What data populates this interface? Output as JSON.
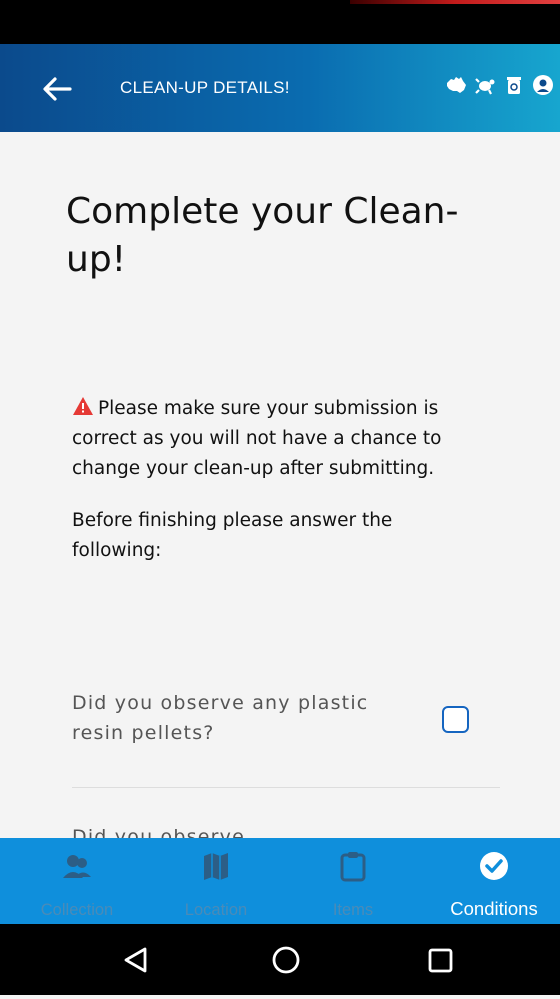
{
  "app_bar": {
    "title": "CLEAN-UP DETAILS!"
  },
  "page": {
    "title": "Complete your Clean-up!",
    "warning": "Please make sure your submission is correct as you will not have a chance to change your clean-up after submitting.",
    "instruction": "Before finishing please answer the following:",
    "question": "Did you observe any plastic resin pellets?",
    "next_question_partial": "Did you observe..."
  },
  "tabs": [
    {
      "label": "Collection",
      "icon": "people-icon"
    },
    {
      "label": "Location",
      "icon": "map-icon"
    },
    {
      "label": "Items",
      "icon": "clipboard-icon"
    },
    {
      "label": "Conditions",
      "icon": "check-circle-icon",
      "active": true
    }
  ],
  "colors": {
    "primary": "#0b4a8c",
    "accent": "#17a6cf",
    "tab_bg": "#0f8fdc",
    "warning": "#e53935"
  }
}
